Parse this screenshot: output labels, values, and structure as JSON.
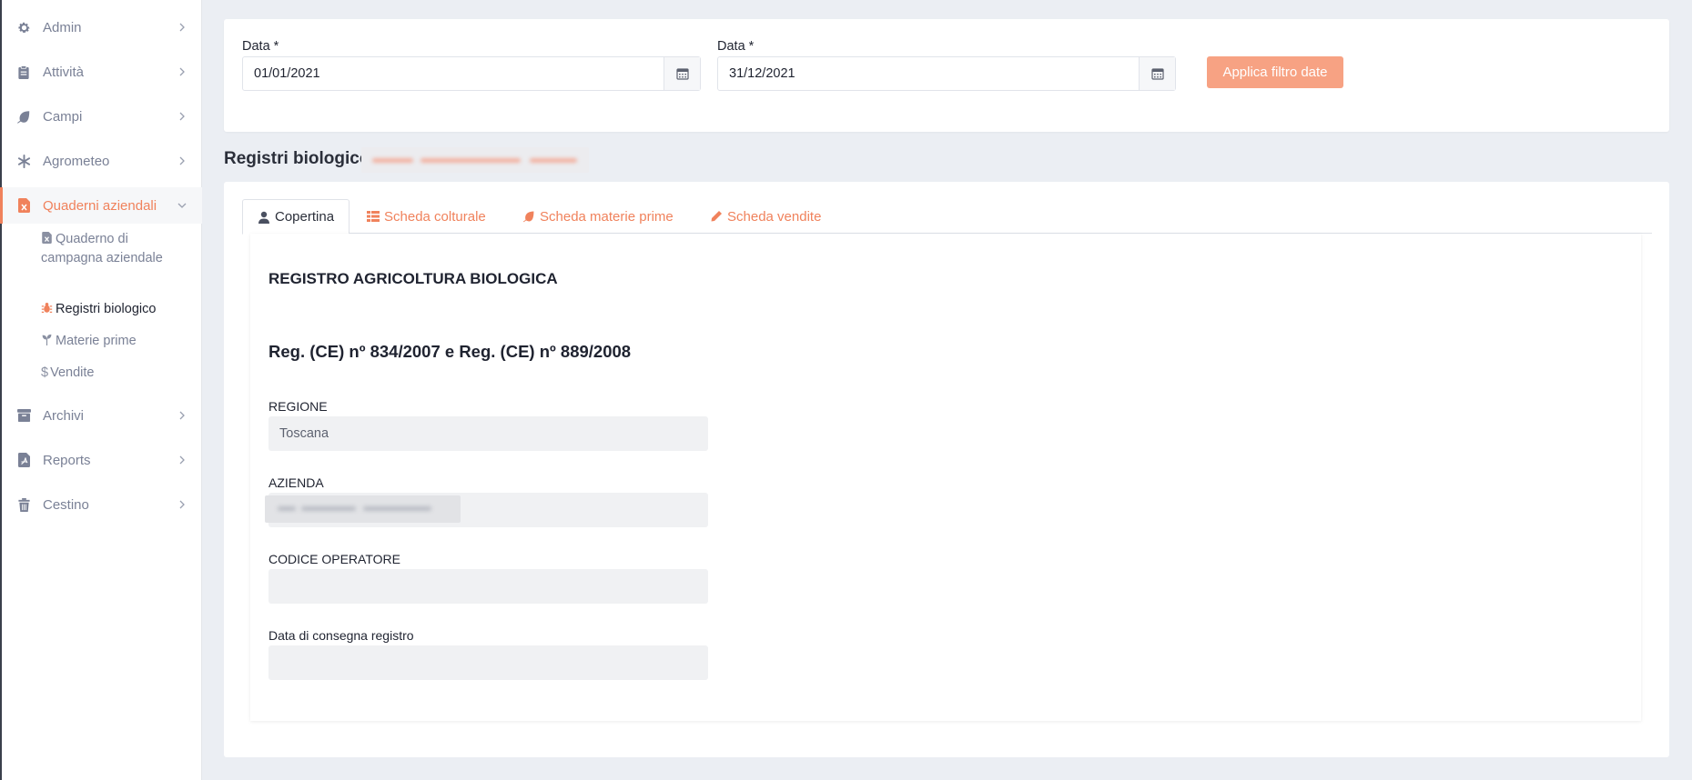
{
  "sidebar": {
    "items": [
      {
        "label": "Admin",
        "icon": "gear-icon"
      },
      {
        "label": "Attività",
        "icon": "clipboard-icon"
      },
      {
        "label": "Campi",
        "icon": "leaf-icon"
      },
      {
        "label": "Agrometeo",
        "icon": "snowflake-icon"
      },
      {
        "label": "Quaderni aziendali",
        "icon": "excel-file-icon"
      },
      {
        "label": "Archivi",
        "icon": "archive-icon"
      },
      {
        "label": "Reports",
        "icon": "pdf-file-icon"
      },
      {
        "label": "Cestino",
        "icon": "trash-icon"
      }
    ],
    "sub_items": [
      {
        "label": "Quaderno di campagna aziendale",
        "icon": "excel-file-icon"
      },
      {
        "label": "Registri biologico",
        "icon": "bug-icon"
      },
      {
        "label": "Materie prime",
        "icon": "seedling-icon"
      },
      {
        "label": "Vendite",
        "icon": "dollar-icon"
      }
    ]
  },
  "filter": {
    "date_from_label": "Data *",
    "date_from_value": "01/01/2021",
    "date_to_label": "Data *",
    "date_to_value": "31/12/2021",
    "apply_label": "Applica filtro date"
  },
  "section_title": "Registri biologico",
  "tabs": [
    {
      "label": "Copertina",
      "icon": "user-icon"
    },
    {
      "label": "Scheda colturale",
      "icon": "table-icon"
    },
    {
      "label": "Scheda materie prime",
      "icon": "leaf-icon"
    },
    {
      "label": "Scheda vendite",
      "icon": "pencil-icon"
    }
  ],
  "panel": {
    "heading": "REGISTRO AGRICOLTURA BIOLOGICA",
    "subheading": "Reg. (CE) nº 834/2007 e Reg. (CE) nº 889/2008",
    "fields": [
      {
        "label": "REGIONE",
        "value": "Toscana"
      },
      {
        "label": "AZIENDA",
        "value": ""
      },
      {
        "label": "CODICE OPERATORE",
        "value": ""
      },
      {
        "label": "Data di consegna registro",
        "value": ""
      }
    ]
  },
  "colors": {
    "accent": "#f0825c",
    "button": "#f7a283",
    "background": "#ebeef3"
  }
}
